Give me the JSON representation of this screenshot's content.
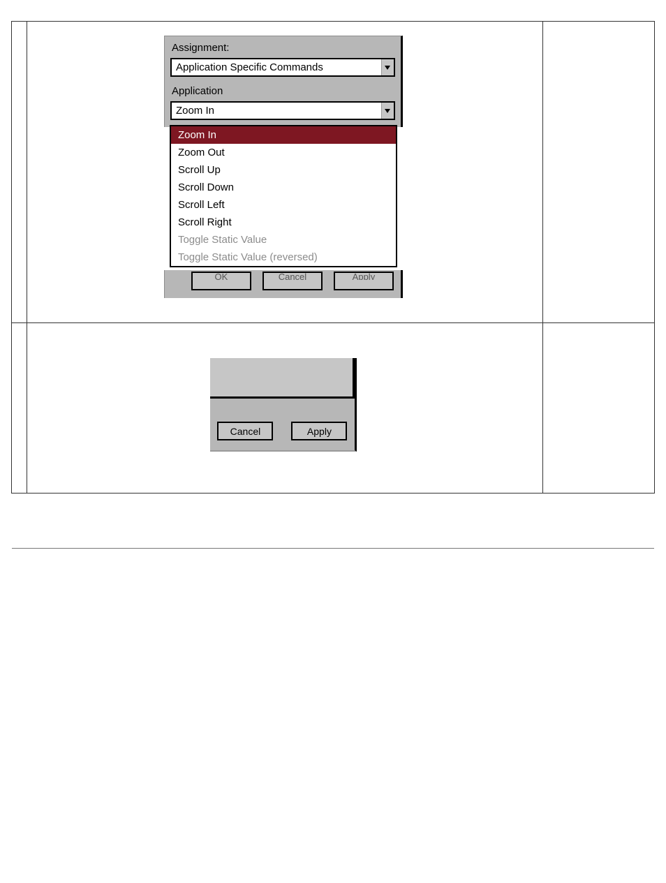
{
  "panel1": {
    "assignment_label": "Assignment:",
    "assignment_value": "Application Specific Commands",
    "application_label": "Application",
    "application_value": "Zoom In",
    "options": [
      {
        "label": "Zoom In",
        "selected": true,
        "disabled": false
      },
      {
        "label": "Zoom Out",
        "selected": false,
        "disabled": false
      },
      {
        "label": "Scroll Up",
        "selected": false,
        "disabled": false
      },
      {
        "label": "Scroll Down",
        "selected": false,
        "disabled": false
      },
      {
        "label": "Scroll Left",
        "selected": false,
        "disabled": false
      },
      {
        "label": "Scroll Right",
        "selected": false,
        "disabled": false
      },
      {
        "label": "Toggle Static Value",
        "selected": false,
        "disabled": true
      },
      {
        "label": "Toggle Static Value (reversed)",
        "selected": false,
        "disabled": true
      }
    ],
    "buttons": {
      "ok": "OK",
      "cancel": "Cancel",
      "apply": "Apply"
    }
  },
  "panel2": {
    "buttons": {
      "cancel": "Cancel",
      "apply": "Apply"
    }
  }
}
